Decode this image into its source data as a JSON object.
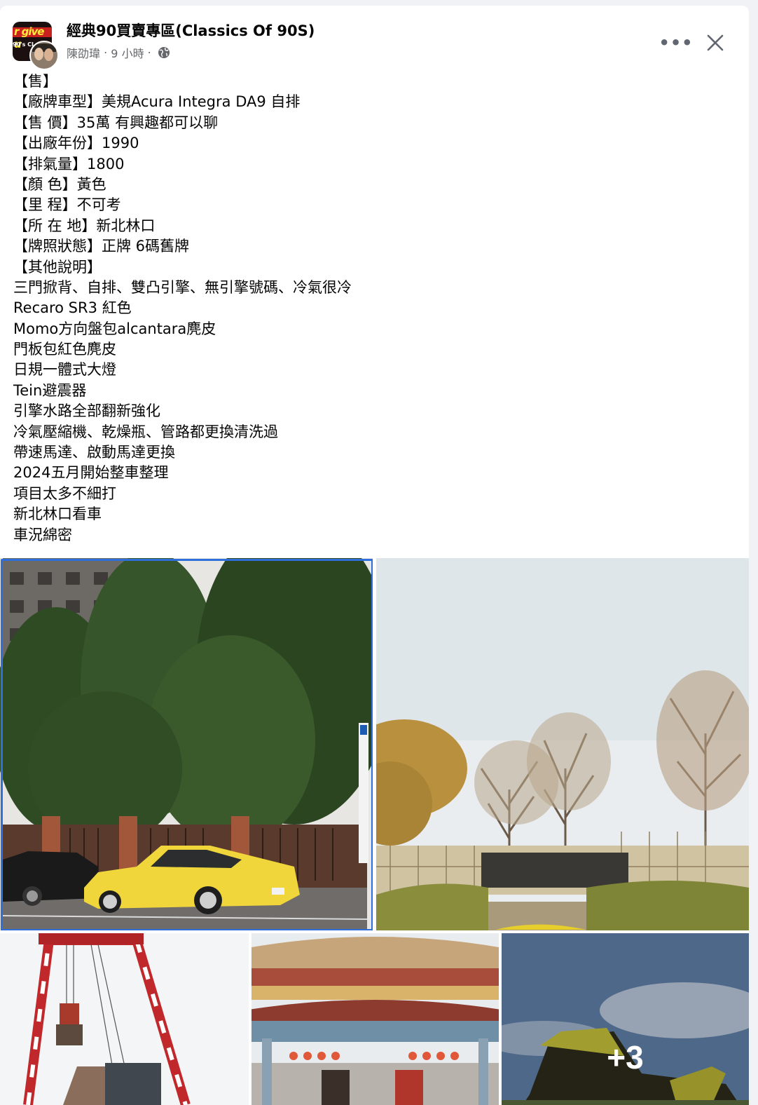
{
  "header": {
    "group_name": "經典90買賣專區(Classics Of 90S)",
    "group_logo_text": "r give u",
    "group_logo_subtext": "90's CL",
    "author": "陳劭瑋",
    "separator": "·",
    "time": "9 小時",
    "privacy_icon": "globe-icon",
    "more_icon": "more-horizontal-icon",
    "more_label": "•••",
    "close_icon": "close-icon"
  },
  "post": {
    "lines": [
      "【售】",
      "【廠牌車型】美規Acura Integra DA9 自排",
      "【售 價】35萬 有興趣都可以聊",
      "【出廠年份】1990",
      "【排氣量】1800",
      "【顏 色】黃色",
      "【里 程】不可考",
      "【所 在 地】新北林口",
      "【牌照狀態】正牌 6碼舊牌",
      "【其他說明】",
      "三門掀背、自排、雙凸引擎、無引擎號碼、冷氣很冷",
      "Recaro SR3 紅色",
      "Momo方向盤包alcantara麂皮",
      "門板包紅色麂皮",
      "日規一體式大燈",
      "Tein避震器",
      "引擎水路全部翻新強化",
      "冷氣壓縮機、乾燥瓶、管路都更換清洗過",
      "帶速馬達、啟動馬達更換",
      "2024五月開始整車整理",
      "項目太多不細打",
      "新北林口看車",
      "車況綿密"
    ]
  },
  "photos": {
    "more_count": "+3",
    "accent_selected": "#2f6fdb"
  }
}
